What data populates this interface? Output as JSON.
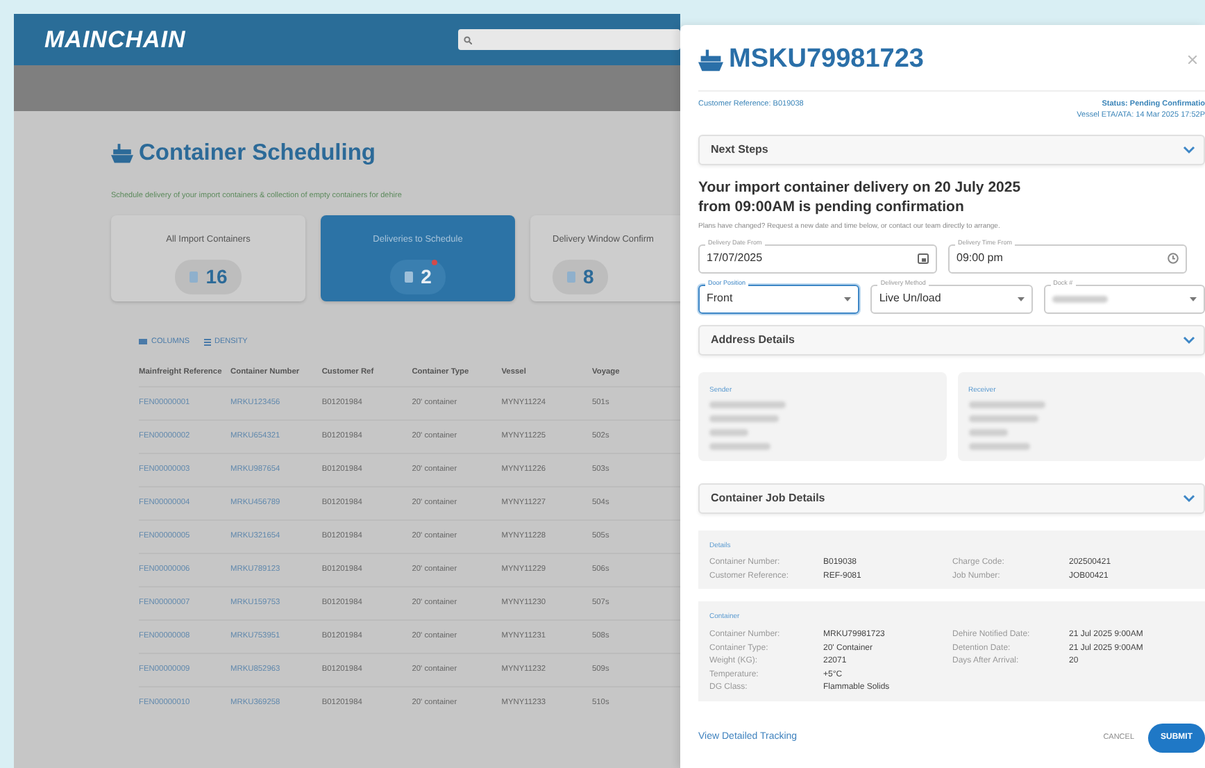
{
  "app": {
    "logo": "MAINCHAIN"
  },
  "page": {
    "title": "Container Scheduling",
    "subtitle": "Schedule delivery of your import containers & collection of empty containers for dehire"
  },
  "summary_cards": [
    {
      "label": "All Import Containers",
      "count": "16",
      "selected": false,
      "alert": false
    },
    {
      "label": "Deliveries to Schedule",
      "count": "2",
      "selected": true,
      "alert": true
    },
    {
      "label": "Delivery Window Confirm",
      "count": "8",
      "selected": false,
      "alert": false
    }
  ],
  "toolbar": [
    {
      "label": "COLUMNS",
      "kind": "columns"
    },
    {
      "label": "DENSITY",
      "kind": "density"
    }
  ],
  "table": {
    "columns": [
      "Mainfreight Reference",
      "Container Number",
      "Customer Ref",
      "Container Type",
      "Vessel",
      "Voyage"
    ],
    "rows": [
      [
        "FEN00000001",
        "MRKU123456",
        "B01201984",
        "20' container",
        "MYNY11224",
        "501s"
      ],
      [
        "FEN00000002",
        "MRKU654321",
        "B01201984",
        "20' container",
        "MYNY11225",
        "502s"
      ],
      [
        "FEN00000003",
        "MRKU987654",
        "B01201984",
        "20' container",
        "MYNY11226",
        "503s"
      ],
      [
        "FEN00000004",
        "MRKU456789",
        "B01201984",
        "20' container",
        "MYNY11227",
        "504s"
      ],
      [
        "FEN00000005",
        "MRKU321654",
        "B01201984",
        "20' container",
        "MYNY11228",
        "505s"
      ],
      [
        "FEN00000006",
        "MRKU789123",
        "B01201984",
        "20' container",
        "MYNY11229",
        "506s"
      ],
      [
        "FEN00000007",
        "MRKU159753",
        "B01201984",
        "20' container",
        "MYNY11230",
        "507s"
      ],
      [
        "FEN00000008",
        "MRKU753951",
        "B01201984",
        "20' container",
        "MYNY11231",
        "508s"
      ],
      [
        "FEN00000009",
        "MRKU852963",
        "B01201984",
        "20' container",
        "MYNY11232",
        "509s"
      ],
      [
        "FEN00000010",
        "MRKU369258",
        "B01201984",
        "20' container",
        "MYNY11233",
        "510s"
      ]
    ]
  },
  "drawer": {
    "title": "MSKU79981723",
    "customer_reference": "Customer Reference: B019038",
    "status": "Status: Pending Confirmatio",
    "vessel_eta": "Vessel ETA/ATA: 14 Mar 2025 17:52P",
    "next_steps": {
      "header": "Next Steps",
      "expanded": true,
      "message": "Your import container delivery on 20 July 2025 from 09:00AM is pending confirmation",
      "hint": "Plans have changed? Request a new date and time below, or contact our team directly to arrange.",
      "fields": [
        {
          "label": "Delivery Date From",
          "value": "17/07/2025",
          "kind": "date",
          "focused": false
        },
        {
          "label": "Delivery Time From",
          "value": "09:00 pm",
          "kind": "time",
          "focused": false
        },
        {
          "label": "Door Position",
          "value": "Front",
          "kind": "select",
          "focused": true
        },
        {
          "label": "Delivery Method",
          "value": "Live Un/load",
          "kind": "select",
          "focused": false
        },
        {
          "label": "Dock #",
          "kind": "select",
          "focused": false,
          "blurred": true
        }
      ]
    },
    "address": {
      "header": "Address Details",
      "expanded": true,
      "cards": [
        {
          "label": "Sender",
          "lines": [
            {
              "kind": "blurred"
            },
            {
              "kind": "blurred"
            },
            {
              "kind": "blurred"
            },
            {
              "kind": "blurred"
            }
          ]
        },
        {
          "label": "Receiver",
          "lines": [
            {
              "kind": "blurred"
            },
            {
              "kind": "blurred"
            },
            {
              "kind": "blurred"
            },
            {
              "kind": "blurred"
            }
          ]
        }
      ]
    },
    "job_details": {
      "header": "Container Job Details",
      "expanded": true,
      "groups": [
        {
          "title": "Details",
          "rows": [
            [
              {
                "label": "Container Number:",
                "value": "B019038"
              },
              {
                "label": "Charge Code:",
                "value": "202500421"
              }
            ],
            [
              {
                "label": "Customer Reference:",
                "value": "REF-9081"
              },
              {
                "label": "Job Number:",
                "value": "JOB00421"
              }
            ]
          ]
        },
        {
          "title": "Container",
          "rows": [
            [
              {
                "label": "Container Number:",
                "value": "MRKU79981723"
              },
              {
                "label": "Dehire Notified Date:",
                "value": "21 Jul 2025  9:00AM"
              }
            ],
            [
              {
                "label": "Container Type:",
                "value": "20' Container"
              },
              {
                "label": "Detention Date:",
                "value": "21 Jul 2025  9:00AM"
              }
            ],
            [
              {
                "label": "Weight (KG):",
                "value": "22071"
              },
              {
                "label": "Days After Arrival:",
                "value": "20"
              }
            ],
            [
              {
                "label": "Temperature:",
                "value": "+5°C"
              }
            ],
            [
              {
                "label": "DG Class:",
                "value": "Flammable Solids"
              }
            ]
          ]
        }
      ]
    },
    "footer": {
      "link": "View Detailed Tracking",
      "cancel": "CANCEL",
      "submit": "SUBMIT"
    }
  }
}
